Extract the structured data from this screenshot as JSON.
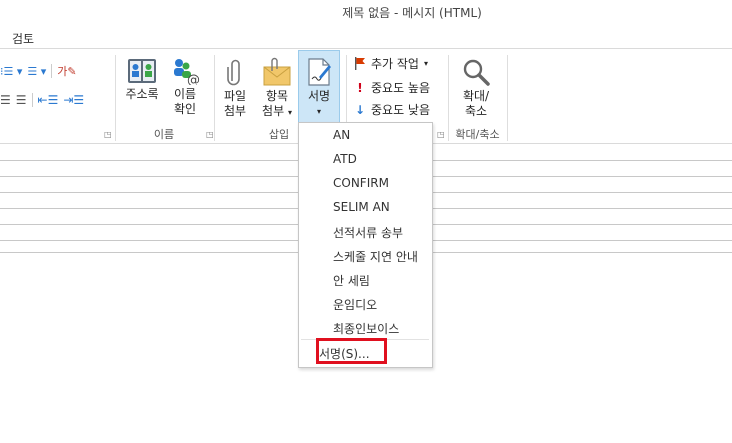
{
  "window": {
    "title": "제목 없음 - 메시지 (HTML)"
  },
  "tabs": {
    "review": "검토"
  },
  "groups": {
    "names": {
      "label": "이름"
    },
    "insert": {
      "label": "삽입"
    },
    "zoom": {
      "label": "확대/축소"
    }
  },
  "buttons": {
    "address_book": "주소록",
    "check_names": [
      "이름",
      "확인"
    ],
    "attach_file": [
      "파일",
      "첨부"
    ],
    "attach_item": [
      "항목",
      "첨부"
    ],
    "signature": "서명",
    "follow_up": "추가 작업",
    "high_importance": "중요도 높음",
    "low_importance": "중요도 낮음",
    "zoom": [
      "확대/",
      "축소"
    ]
  },
  "signature_menu": {
    "items": [
      "AN",
      "ATD",
      "CONFIRM",
      "SELIM AN",
      "선적서류 송부",
      "스케줄 지연 안내",
      "안 세림",
      "운임디오",
      "최종인보이스"
    ],
    "signatures_command": "서명(S)..."
  },
  "colors": {
    "accent": "#2b79d0",
    "flag": "#d83b01",
    "highlight": "#e0101f"
  }
}
